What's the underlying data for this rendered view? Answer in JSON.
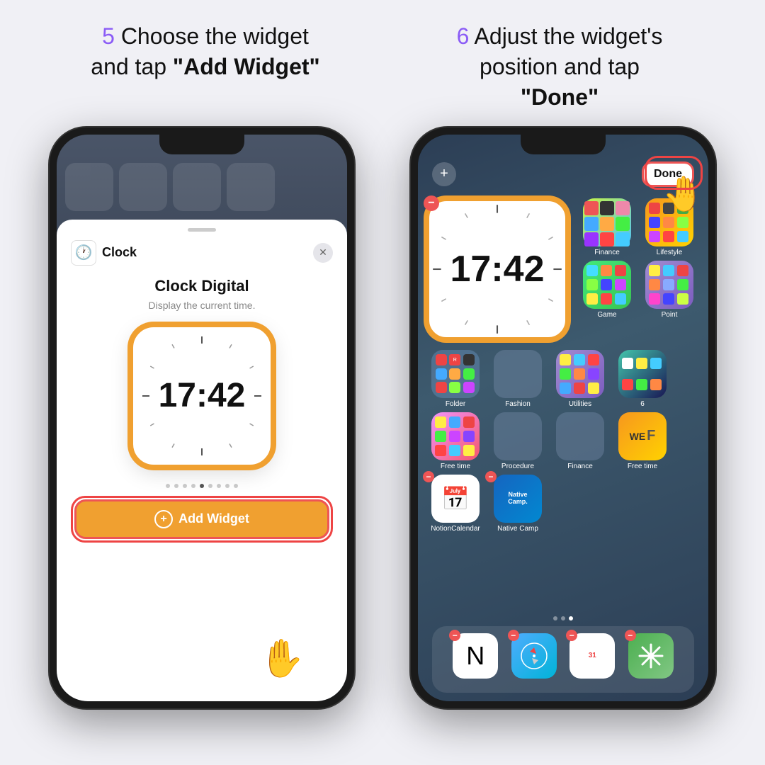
{
  "background": "#f0f0f5",
  "step5": {
    "number": "5",
    "text_part1": " Choose the widget",
    "text_part2": "and tap ",
    "bold_text": "\"Add Widget\""
  },
  "step6": {
    "number": "6",
    "text_part1": " Adjust the widget's",
    "text_part2": "position and tap",
    "bold_text": "\"Done\""
  },
  "phone1": {
    "sheet_title": "Clock",
    "widget_name": "Clock Digital",
    "widget_desc": "Display the current time.",
    "clock_time": "17:42",
    "add_widget_label": "Add Widget",
    "page_dots": [
      false,
      false,
      false,
      false,
      true,
      false,
      false,
      false,
      false
    ]
  },
  "phone2": {
    "done_label": "Done",
    "plus_label": "+",
    "clock_time": "17:42",
    "app_labels": {
      "finance_top": "Finance",
      "lifestyle": "Lifestyle",
      "game": "Game",
      "point": "Point",
      "folder": "Folder",
      "fashion": "Fashion",
      "utilities": "Utilities",
      "six": "6",
      "free_time": "Free time",
      "procedure": "Procedure",
      "finance_bottom": "Finance",
      "free_time2": "Free time",
      "notion": "NotionCalendar",
      "native_camp": "Native Camp"
    },
    "page_dots": [
      false,
      false,
      true
    ]
  }
}
